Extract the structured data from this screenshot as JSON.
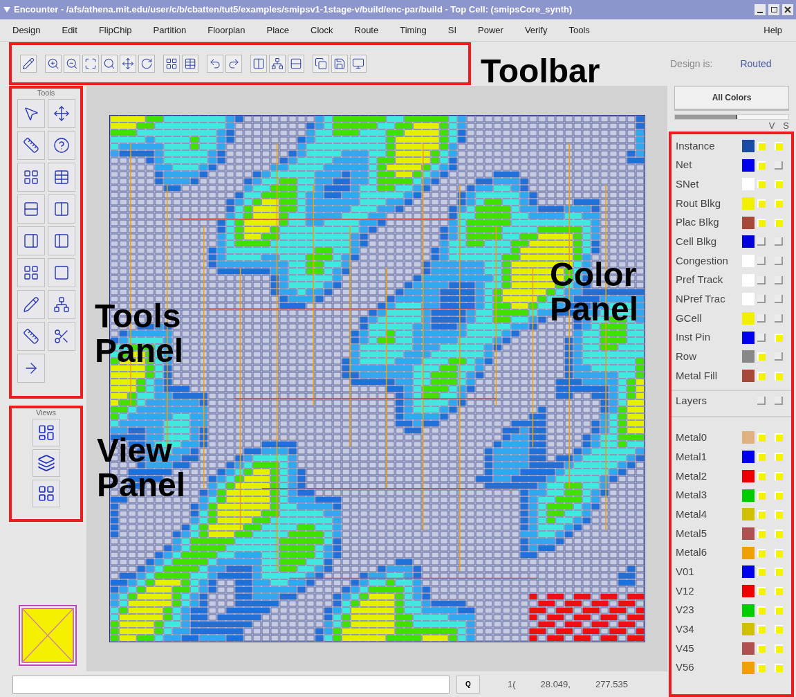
{
  "window": {
    "title": "Encounter - /afs/athena.mit.edu/user/c/b/cbatten/tut5/examples/smipsv1-1stage-v/build/enc-par/build - Top Cell: (smipsCore_synth)"
  },
  "menu": [
    "Design",
    "Edit",
    "FlipChip",
    "Partition",
    "Floorplan",
    "Place",
    "Clock",
    "Route",
    "Timing",
    "SI",
    "Power",
    "Verify",
    "Tools"
  ],
  "help_menu": "Help",
  "design_state": {
    "label": "Design is:",
    "value": "Routed"
  },
  "tools_panel": {
    "title": "Tools"
  },
  "views_panel": {
    "title": "Views"
  },
  "color_panel": {
    "button": "All Colors",
    "slider": {
      "level": 0.55
    },
    "headers": [
      "V",
      "S"
    ],
    "items": [
      {
        "label": "Instance",
        "color": "#1a4aa8",
        "v": true,
        "s": true
      },
      {
        "label": "Net",
        "color": "#0000ee",
        "v": true,
        "s": false
      },
      {
        "label": "SNet",
        "color": "#ffffff",
        "v": true,
        "s": true
      },
      {
        "label": "Rout Blkg",
        "color": "#f0f000",
        "v": true,
        "s": true
      },
      {
        "label": "Plac Blkg",
        "color": "#a84838",
        "v": true,
        "s": true
      },
      {
        "label": "Cell Blkg",
        "color": "#0000dd",
        "v": false,
        "s": false
      },
      {
        "label": "Congestion",
        "color": "#ffffff",
        "v": false,
        "s": false
      },
      {
        "label": "Pref Track",
        "color": "#ffffff",
        "v": false,
        "s": false
      },
      {
        "label": "NPref Trac",
        "color": "#ffffff",
        "v": false,
        "s": false
      },
      {
        "label": "GCell",
        "color": "#f0f000",
        "v": false,
        "s": false
      },
      {
        "label": "Inst Pin",
        "color": "#0000ee",
        "v": false,
        "s": true
      },
      {
        "label": "Row",
        "color": "#888888",
        "v": true,
        "s": false
      },
      {
        "label": "Metal Fill",
        "color": "#a84838",
        "v": true,
        "s": true
      }
    ],
    "layers": {
      "label": "Layers",
      "v": false,
      "s": false
    },
    "layer_items": [
      {
        "label": "Metal0",
        "color": "#e0b080",
        "v": true,
        "s": true
      },
      {
        "label": "Metal1",
        "color": "#0000ee",
        "v": true,
        "s": true
      },
      {
        "label": "Metal2",
        "color": "#ee0000",
        "v": true,
        "s": true
      },
      {
        "label": "Metal3",
        "color": "#00cc00",
        "v": true,
        "s": true
      },
      {
        "label": "Metal4",
        "color": "#d0c000",
        "v": true,
        "s": true
      },
      {
        "label": "Metal5",
        "color": "#b05050",
        "v": true,
        "s": true
      },
      {
        "label": "Metal6",
        "color": "#f0a000",
        "v": true,
        "s": true
      },
      {
        "label": "V01",
        "color": "#0000ee",
        "v": true,
        "s": true
      },
      {
        "label": "V12",
        "color": "#ee0000",
        "v": true,
        "s": true
      },
      {
        "label": "V23",
        "color": "#00cc00",
        "v": true,
        "s": true
      },
      {
        "label": "V34",
        "color": "#d0c000",
        "v": true,
        "s": true
      },
      {
        "label": "V45",
        "color": "#b05050",
        "v": true,
        "s": true
      },
      {
        "label": "V56",
        "color": "#f0a000",
        "v": true,
        "s": true
      }
    ]
  },
  "status_bar": {
    "button": "Q",
    "fields": [
      "1(",
      "28.049,",
      "277.535"
    ]
  },
  "annotations": [
    {
      "label": "Toolbar"
    },
    {
      "label": "Tools Panel"
    },
    {
      "label": "View Panel"
    },
    {
      "label": "Color Panel"
    }
  ]
}
